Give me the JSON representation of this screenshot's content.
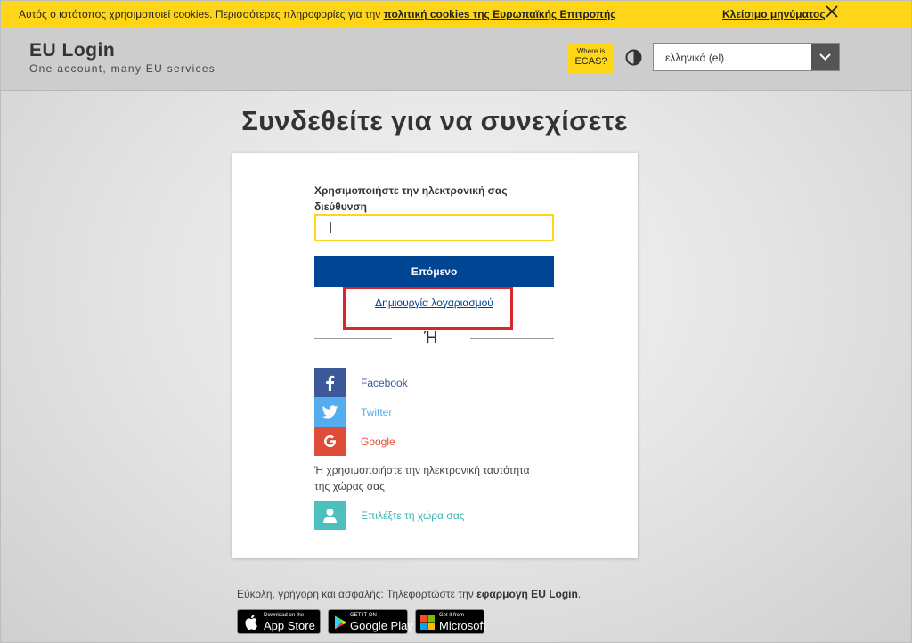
{
  "cookie": {
    "message": "Αυτός ο ιστότοπος χρησιμοποιεί cookies. Περισσότερες πληροφορίες για την ",
    "link": "πολιτική cookies της Ευρωπαϊκής Επιτροπής",
    "close_label": "Κλείσιμο μηνύματος",
    "color": "#ffd617"
  },
  "header": {
    "title": "EU Login",
    "subtitle": "One account, many EU services",
    "ecas_line1": "Where is",
    "ecas_line2": "ECAS?",
    "contrast_icon": "contrast-icon",
    "language": "ελληνικά (el)"
  },
  "main": {
    "title": "Συνδεθείτε για να συνεχίσετε",
    "email_label": "Χρησιμοποιήστε την ηλεκτρονική σας διεύθυνση",
    "email_value": "",
    "next_label": "Επόμενο",
    "create_account": "Δημιουργία λογαριασμού",
    "or_label": "Ή",
    "primary_color": "#004494"
  },
  "social": [
    {
      "label": "Facebook",
      "icon": "facebook-icon",
      "color": "#3b5998"
    },
    {
      "label": "Twitter",
      "icon": "twitter-icon",
      "color": "#55acee"
    },
    {
      "label": "Google",
      "icon": "google-icon",
      "color": "#dd4b39"
    }
  ],
  "eid": {
    "text": "Ή χρησιμοποιήστε την ηλεκτρονική ταυτότητα της χώρας σας",
    "label": "Επιλέξτε τη χώρα σας",
    "icon": "person-icon",
    "color": "#4cbfbf"
  },
  "footer": {
    "app_text_prefix": "Εύκολη, γρήγορη και ασφαλής: Τηλεφορτώστε την ",
    "app_text_bold": "εφαρμογή EU Login",
    "app_text_suffix": ".",
    "badges": [
      {
        "small": "Download on the",
        "big": "App Store",
        "icon": "apple-icon"
      },
      {
        "small": "GET IT ON",
        "big": "Google Play",
        "icon": "google-play-icon"
      },
      {
        "small": "Get it from",
        "big": "Microsoft",
        "icon": "microsoft-icon"
      }
    ]
  }
}
